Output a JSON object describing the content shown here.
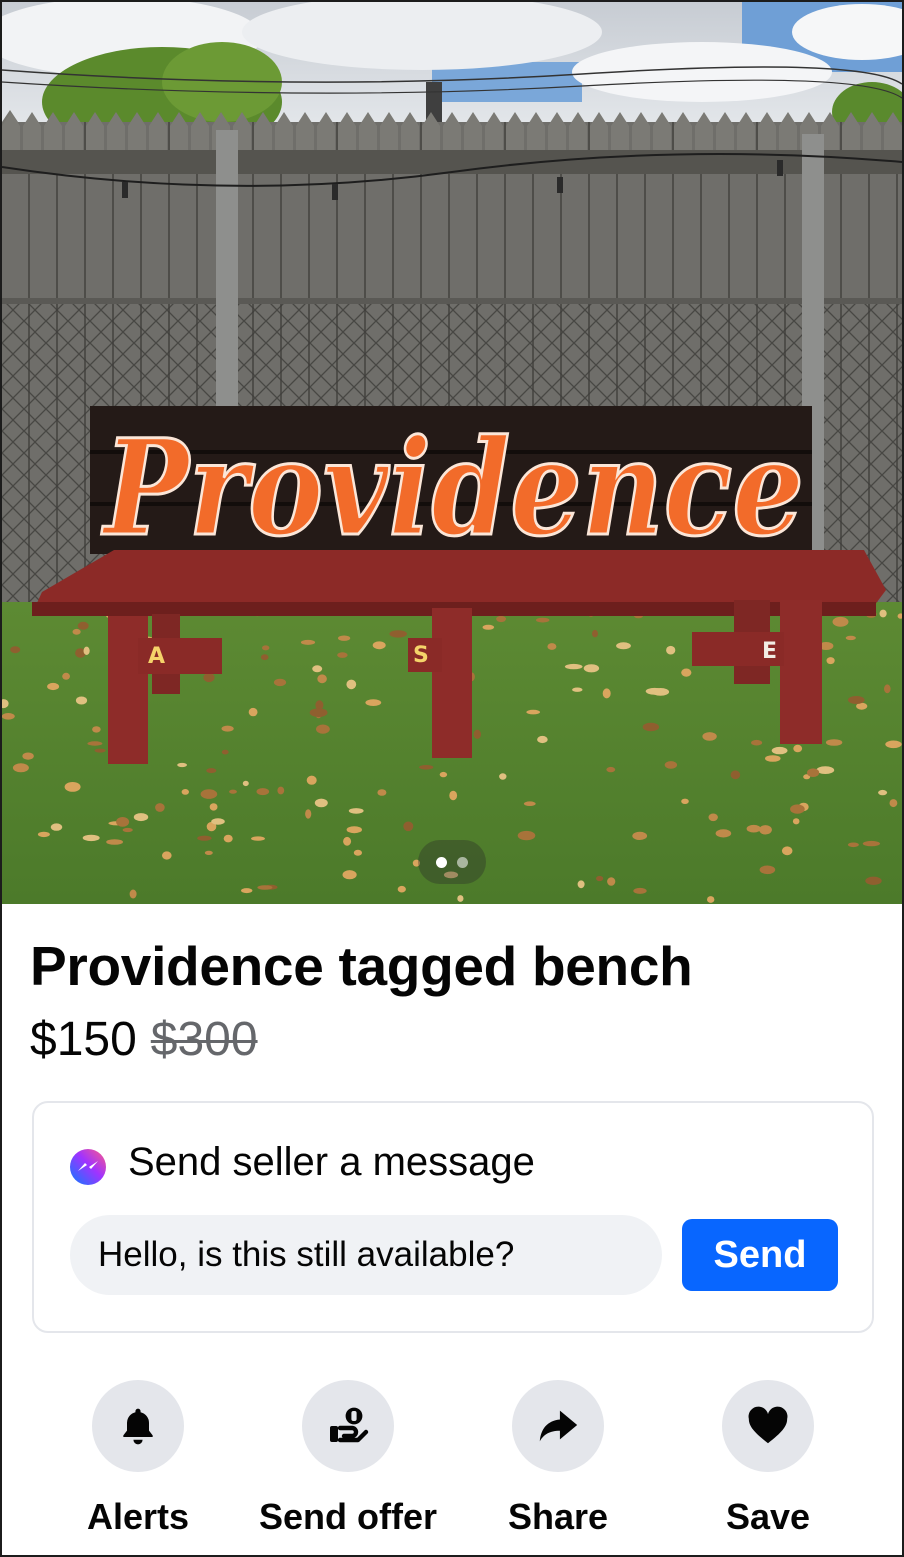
{
  "photo": {
    "bench_text": "Providence",
    "leg_tags": [
      "A",
      "S",
      "E"
    ],
    "current_index": 1,
    "count": 2
  },
  "listing": {
    "title": "Providence tagged bench",
    "price": "$150",
    "original_price": "$300"
  },
  "message_card": {
    "icon": "messenger-icon",
    "title": "Send seller a message",
    "input_value": "Hello, is this still available?",
    "send_label": "Send"
  },
  "actions": [
    {
      "label": "Alerts",
      "icon": "bell-icon"
    },
    {
      "label": "Send offer",
      "icon": "offer-icon"
    },
    {
      "label": "Share",
      "icon": "share-arrow-icon"
    },
    {
      "label": "Save",
      "icon": "heart-icon"
    }
  ],
  "colors": {
    "accent": "#0866ff",
    "chip_bg": "#e4e6eb",
    "input_bg": "#f0f2f5",
    "muted_text": "#65676b"
  }
}
